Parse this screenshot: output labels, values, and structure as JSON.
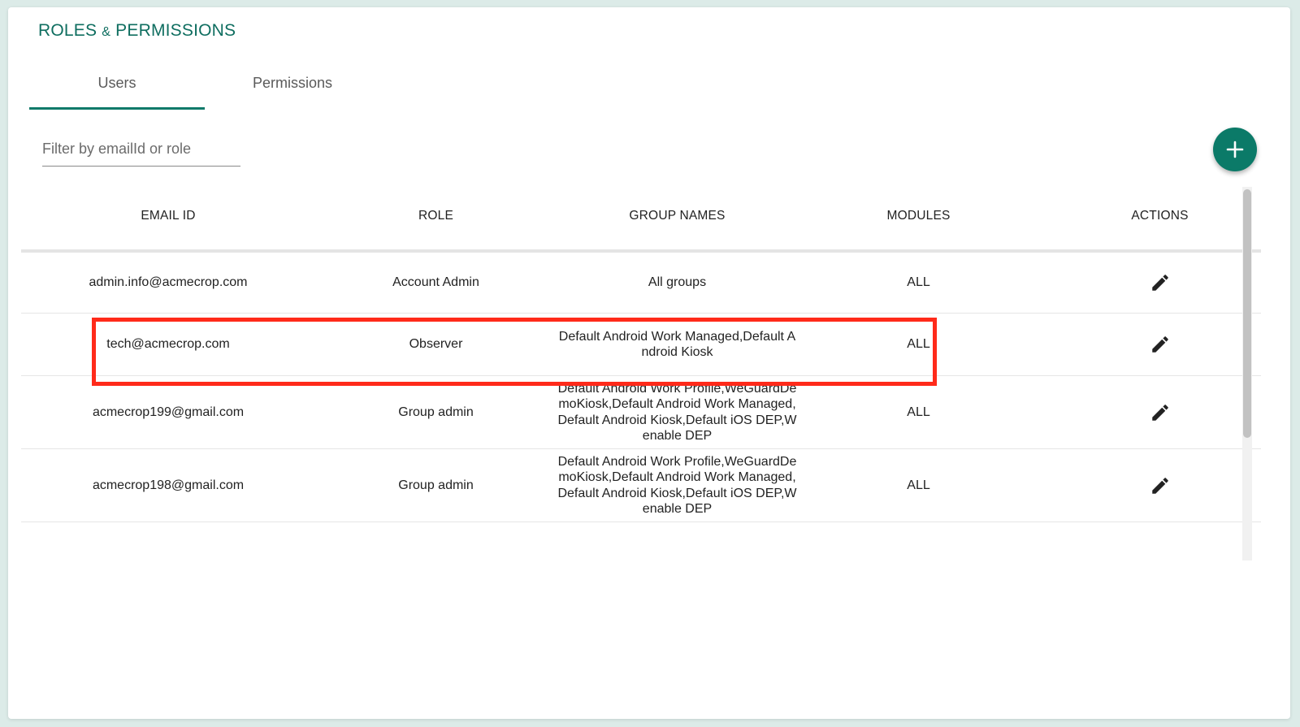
{
  "header": {
    "title_part1": "ROLES",
    "title_amp": "&",
    "title_part2": "PERMISSIONS"
  },
  "tabs": [
    {
      "label": "Users",
      "active": true
    },
    {
      "label": "Permissions",
      "active": false
    }
  ],
  "filter": {
    "placeholder": "Filter by emailId or role",
    "value": ""
  },
  "add_button": {
    "icon": "plus-icon"
  },
  "table": {
    "columns": [
      "EMAIL ID",
      "ROLE",
      "GROUP NAMES",
      "MODULES",
      "ACTIONS"
    ],
    "rows": [
      {
        "email": "admin.info@acmecrop.com",
        "role": "Account Admin",
        "groups": "All groups",
        "modules": "ALL",
        "action_icon": "pencil-icon"
      },
      {
        "email": "tech@acmecrop.com",
        "role": "Observer",
        "groups": "Default Android Work Managed,Default Android Kiosk",
        "modules": "ALL",
        "action_icon": "pencil-icon",
        "highlighted": true
      },
      {
        "email": "acmecrop199@gmail.com",
        "role": "Group admin",
        "groups": "Default Android Work Profile,WeGuardDemoKiosk,Default Android Work Managed,Default Android Kiosk,Default iOS DEP,Wenable DEP",
        "modules": "ALL",
        "action_icon": "pencil-icon"
      },
      {
        "email": "acmecrop198@gmail.com",
        "role": "Group admin",
        "groups": "Default Android Work Profile,WeGuardDemoKiosk,Default Android Work Managed,Default Android Kiosk,Default iOS DEP,Wenable DEP",
        "modules": "ALL",
        "action_icon": "pencil-icon"
      }
    ]
  },
  "colors": {
    "accent": "#0f7a6a",
    "highlight": "#ff2a1a"
  }
}
